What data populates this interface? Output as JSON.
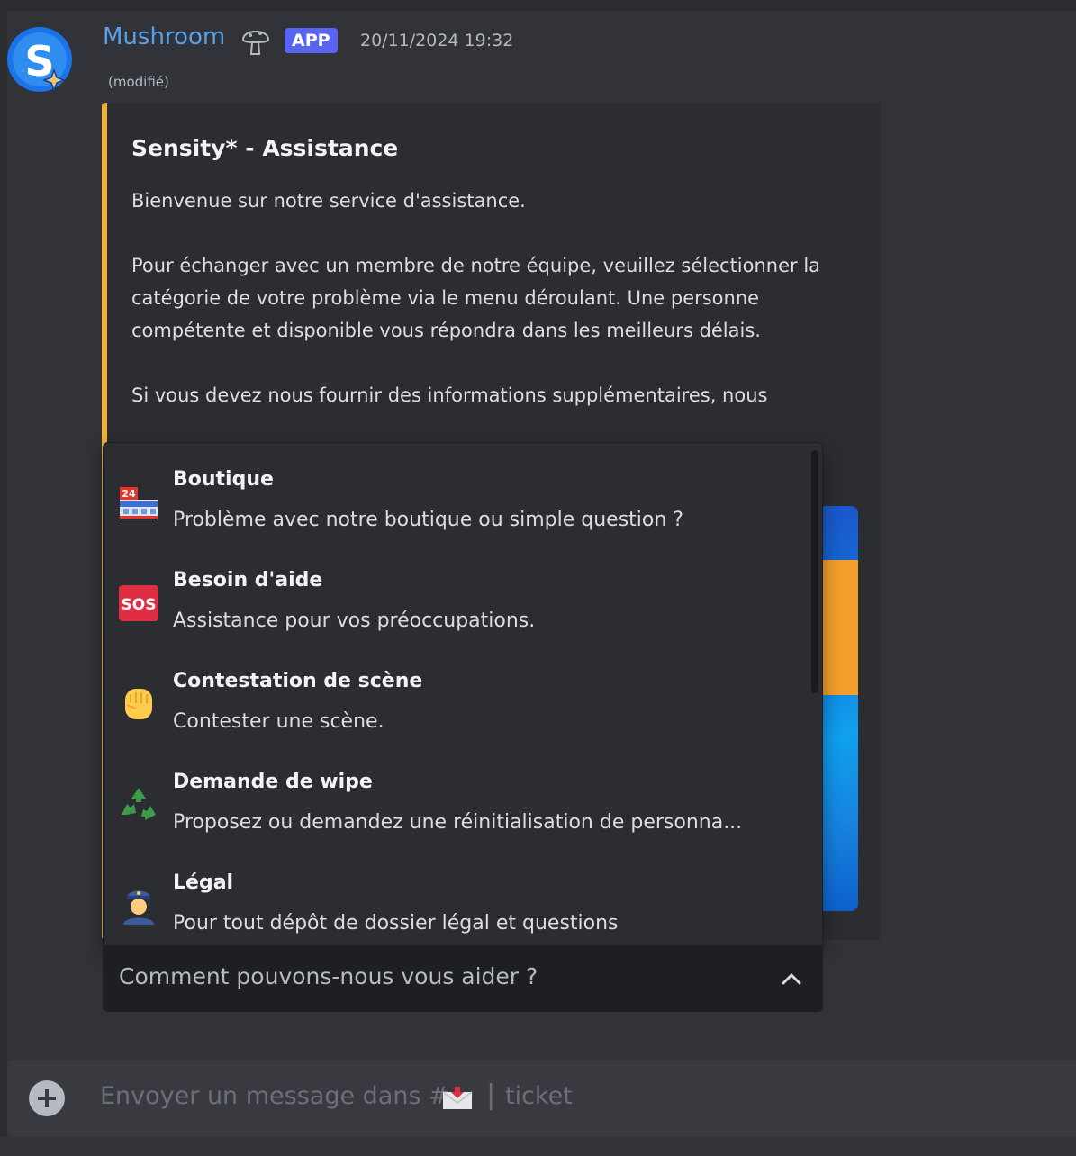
{
  "message": {
    "author": "Mushroom",
    "badge": "APP",
    "timestamp": "20/11/2024 19:32",
    "edited": "(modifié)",
    "avatar_letter": "S"
  },
  "embed": {
    "accent_color": "#f0b232",
    "title": "Sensity* - Assistance",
    "description": "Bienvenue sur notre service d'assistance.\n\nPour échanger avec un membre de notre équipe, veuillez sélectionner la catégorie de votre problème via le menu déroulant. Une personne compétente et disponible vous répondra dans les meilleurs délais.\n\nSi vous devez nous fournir des informations supplémentaires, nous"
  },
  "select_menu": {
    "placeholder": "Comment pouvons-nous vous aider ?",
    "options": [
      {
        "label": "Boutique",
        "description": "Problème avec notre boutique ou simple question ?",
        "icon": "convenience-store-icon"
      },
      {
        "label": "Besoin d'aide",
        "description": "Assistance pour vos préoccupations.",
        "icon": "sos-icon"
      },
      {
        "label": "Contestation de scène",
        "description": "Contester une scène.",
        "icon": "raised-fist-icon"
      },
      {
        "label": "Demande de wipe",
        "description": "Proposez ou demandez une réinitialisation de personna...",
        "icon": "recycle-icon"
      },
      {
        "label": "Légal",
        "description": "Pour tout dépôt de dossier légal et questions",
        "icon": "police-officer-icon"
      }
    ]
  },
  "composer": {
    "placeholder_prefix": "Envoyer un message dans #",
    "channel_separator": "|",
    "channel_name": "ticket"
  },
  "colors": {
    "background": "#313338",
    "embed_background": "#2b2d31",
    "username": "#5aa0e8",
    "app_badge": "#5865f2"
  }
}
